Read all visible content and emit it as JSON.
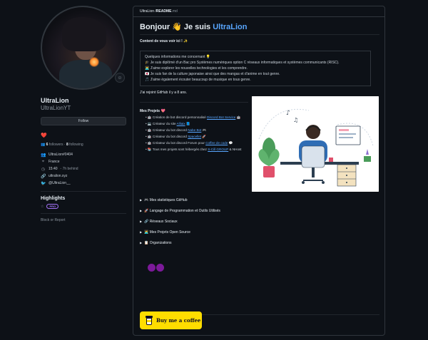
{
  "profile": {
    "name": "UltraLion",
    "login": "UltraLionYT",
    "follow_label": "Follow",
    "heart": "❤️",
    "followers_count": "6",
    "followers_label": "followers",
    "following_count": "8",
    "following_label": "following",
    "details": [
      {
        "icon": "discord-icon",
        "glyph": "👥",
        "text": "UltraLion#0404",
        "muted": ""
      },
      {
        "icon": "location-icon",
        "glyph": "⌖",
        "text": "France",
        "muted": ""
      },
      {
        "icon": "clock-icon",
        "glyph": "◷",
        "text": "15:40",
        "muted": "- 7h behind"
      },
      {
        "icon": "link-icon",
        "glyph": "🔗",
        "text": "ultralion.xyz",
        "muted": ""
      },
      {
        "icon": "twitter-icon",
        "glyph": "🐦",
        "text": "@UltraLion__",
        "muted": ""
      }
    ],
    "highlights_title": "Highlights",
    "pro_badge": "PRO",
    "block_label": "Block or Report"
  },
  "readme": {
    "path_prefix": "UltraLion / ",
    "path_file": "README",
    "path_ext": ".md",
    "greeting": "Bonjour",
    "greeting_emoji": "👋",
    "greeting_rest": "Je suis",
    "name_accent": "UltraLion",
    "intro": "Content de vous voir ici ! ✨",
    "info_lines": [
      "Quelques informations me concernant 💡",
      "🎓 Je suis diplômé d'un Bac pro Systèmes numériques option C réseaux informatiques et systèmes communicants (RISC).",
      "👨‍💻 J'aime explorer les nouvelles technologies et les comprendre.",
      "🇯🇵 Je suis fan de la culture japonaise ainsi que des mangas et d'anime en tout genre.",
      "🎵 J'aime également écouter beaucoup de musique en tous genre."
    ],
    "joined": "J'ai rejoint GitHub il y a 8 ans.",
    "projects_title": "Mes Projets 💖",
    "projects": [
      {
        "pre": "🤖 Création de bot discord personnalisé",
        "link": "Discord Bot Service",
        "post": "🤖"
      },
      {
        "pre": "💻 Créateur du site",
        "link": "Alliaix",
        "post": "📘"
      },
      {
        "pre": "🤖 Créateur du bot discord",
        "link": "Nabe Bot",
        "post": "🎮"
      },
      {
        "pre": "🤖 Créateur du bot discord",
        "link": "Spacellet",
        "post": "🚀"
      },
      {
        "pre": "🤖 Créateur du bot discord Forum pour",
        "link": "Coffee de code",
        "post": "💬"
      },
      {
        "pre": "📚 Tous mes projets sont hébergés chez",
        "link": "S-Cill GROUP",
        "post": "& NHost"
      }
    ],
    "sections": [
      "🎮 Mes statistiques GitHub",
      "🚀 Langage de Programmation et Outils Utilisés",
      "🔗 Réseaux Sociaux",
      "🧑‍💻 Mes Projets Open Source",
      "📋 Organizations"
    ],
    "coffee_label": "Buy me a coffee"
  },
  "colors": {
    "background": "#0d1117",
    "accent": "#58a6ff",
    "pro": "#a371f7",
    "coffee": "#ffdd00",
    "heart": "#ff4d6d"
  }
}
